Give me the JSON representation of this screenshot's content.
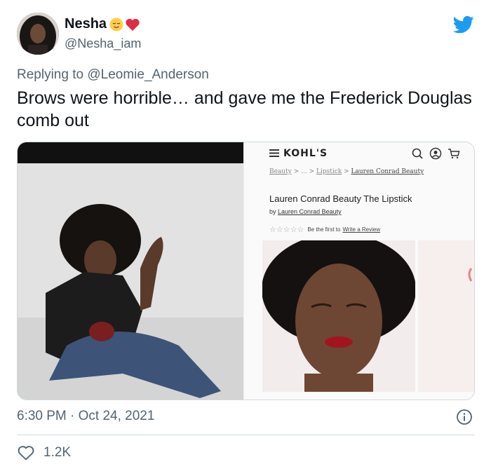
{
  "user": {
    "display_name": "Nesha",
    "handle": "@Nesha_iam"
  },
  "icons": {
    "brand": "twitter-bird-icon",
    "emoji_1": "relieved-face-emoji",
    "emoji_2": "red-heart-emoji",
    "info": "info-icon",
    "like": "heart-outline-icon"
  },
  "reply": {
    "prefix": "Replying to",
    "mention": "@Leomie_Anderson"
  },
  "tweet": {
    "text": "Brows were horrible… and gave me the Frederick Douglas comb out"
  },
  "media": {
    "right_panel": {
      "logo": "KOHL'S",
      "breadcrumb": {
        "item1": "Beauty",
        "sep": ">",
        "ellipsis": "...",
        "item2": "Lipstick",
        "item3": "Lauren Conrad Beauty"
      },
      "product_title": "Lauren Conrad Beauty The Lipstick",
      "by_prefix": "by",
      "brand": "Lauren Conrad Beauty",
      "stars": "☆☆☆☆☆",
      "rating_prefix": "Be the first to",
      "review_link": "Write a Review"
    }
  },
  "meta": {
    "timestamp": "6:30 PM · Oct 24, 2021",
    "like_count": "1.2K"
  },
  "colors": {
    "twitter_blue": "#1d9bf0",
    "muted_text": "#536471",
    "border": "#cfd9de"
  }
}
